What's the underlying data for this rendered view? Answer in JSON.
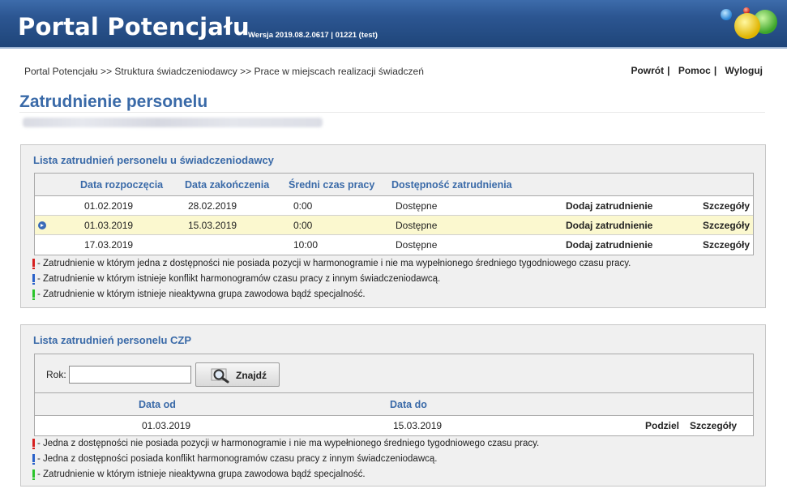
{
  "header": {
    "title": "Portal Potencjału",
    "version": "Wersja 2019.08.2.0617 | 01221 (test)"
  },
  "breadcrumb": "Portal Potencjału >> Struktura świadczeniodawcy >> Prace w miejscach realizacji świadczeń",
  "toplinks": {
    "back": "Powrót",
    "help": "Pomoc",
    "logout": "Wyloguj",
    "separator": "|"
  },
  "page_title": "Zatrudnienie personelu",
  "panel1": {
    "title": "Lista zatrudnień personelu u świadczeniodawcy",
    "columns": [
      "Data rozpoczęcia",
      "Data zakończenia",
      "Średni czas pracy",
      "Dostępność zatrudnienia"
    ],
    "rows": [
      {
        "start": "01.02.2019",
        "end": "28.02.2019",
        "avg": "0:00",
        "avail": "Dostępne",
        "action": "Dodaj zatrudnienie",
        "details": "Szczegóły"
      },
      {
        "start": "01.03.2019",
        "end": "15.03.2019",
        "avg": "0:00",
        "avail": "Dostępne",
        "action": "Dodaj zatrudnienie",
        "details": "Szczegóły"
      },
      {
        "start": "17.03.2019",
        "end": "",
        "avg": "10:00",
        "avail": "Dostępne",
        "action": "Dodaj zatrudnienie",
        "details": "Szczegóły"
      }
    ],
    "legend": [
      {
        "color": "#d62020",
        "text": "- Zatrudnienie w którym jedna z dostępności nie posiada pozycji w harmonogramie i nie ma wypełnionego średniego tygodniowego czasu pracy."
      },
      {
        "color": "#2a62c9",
        "text": "- Zatrudnienie w którym istnieje konflikt harmonogramów czasu pracy z innym świadczeniodawcą."
      },
      {
        "color": "#2bc42b",
        "text": "- Zatrudnienie w którym istnieje nieaktywna grupa zawodowa bądź specjalność."
      }
    ]
  },
  "panel2": {
    "title": "Lista zatrudnień personelu CZP",
    "search": {
      "label": "Rok:",
      "value": "",
      "button": "Znajdź"
    },
    "columns": [
      "Data od",
      "Data do"
    ],
    "rows": [
      {
        "from": "01.03.2019",
        "to": "15.03.2019",
        "split": "Podziel",
        "details": "Szczegóły"
      }
    ],
    "legend": [
      {
        "color": "#d62020",
        "text": "- Jedna z dostępności nie posiada pozycji w harmonogramie i nie ma wypełnionego średniego tygodniowego czasu pracy."
      },
      {
        "color": "#2a62c9",
        "text": "- Jedna z dostępności posiada konflikt harmonogramów czasu pracy z innym świadczeniodawcą."
      },
      {
        "color": "#2bc42b",
        "text": "- Zatrudnienie w którym istnieje nieaktywna grupa zawodowa bądź specjalność."
      }
    ]
  }
}
